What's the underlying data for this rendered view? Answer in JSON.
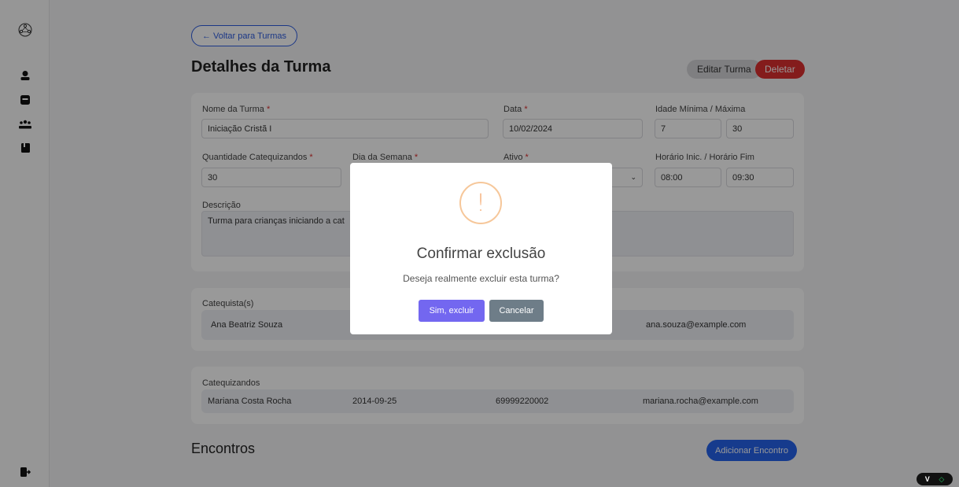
{
  "sidebar": {
    "icons": [
      "logo-icon",
      "user-icon",
      "id-card-icon",
      "group-icon",
      "book-icon",
      "logout-icon"
    ]
  },
  "header": {
    "back_label": "← Voltar para Turmas",
    "title": "Detalhes da Turma",
    "edit_label": "Editar Turma",
    "delete_label": "Deletar"
  },
  "form": {
    "nome_label": "Nome da Turma",
    "nome_value": "Iniciação Cristã I",
    "data_label": "Data",
    "data_value": "10/02/2024",
    "idade_label": "Idade Mínima / Máxima",
    "idade_min": "7",
    "idade_max": "30",
    "qtd_label": "Quantidade Catequizandos",
    "qtd_value": "30",
    "dia_label": "Dia da Semana",
    "ativo_label": "Ativo",
    "horario_label": "Horário Inic. / Horário Fim",
    "horario_inicio": "08:00",
    "horario_fim": "09:30",
    "descricao_label": "Descrição",
    "descricao_value": "Turma para crianças iniciando a cat",
    "required_mark": "*"
  },
  "catequistas": {
    "label": "Catequista(s)",
    "rows": [
      {
        "nome": "Ana Beatriz Souza",
        "email": "ana.souza@example.com"
      }
    ]
  },
  "catequizandos": {
    "label": "Catequizandos",
    "rows": [
      {
        "nome": "Mariana Costa Rocha",
        "nascimento": "2014-09-25",
        "telefone": "69999220002",
        "email": "mariana.rocha@example.com"
      }
    ]
  },
  "encontros": {
    "title": "Encontros",
    "add_label": "Adicionar Encontro"
  },
  "modal": {
    "icon": "!",
    "title": "Confirmar exclusão",
    "text": "Deseja realmente excluir esta turma?",
    "confirm_label": "Sim, excluir",
    "cancel_label": "Cancelar"
  },
  "corner": {
    "v": "V",
    "g": "◇"
  },
  "colors": {
    "primary": "#2563eb",
    "danger": "#dc2f2f",
    "confirm": "#7367f0",
    "cancel": "#6e7d88",
    "warning": "#f6b07a"
  }
}
